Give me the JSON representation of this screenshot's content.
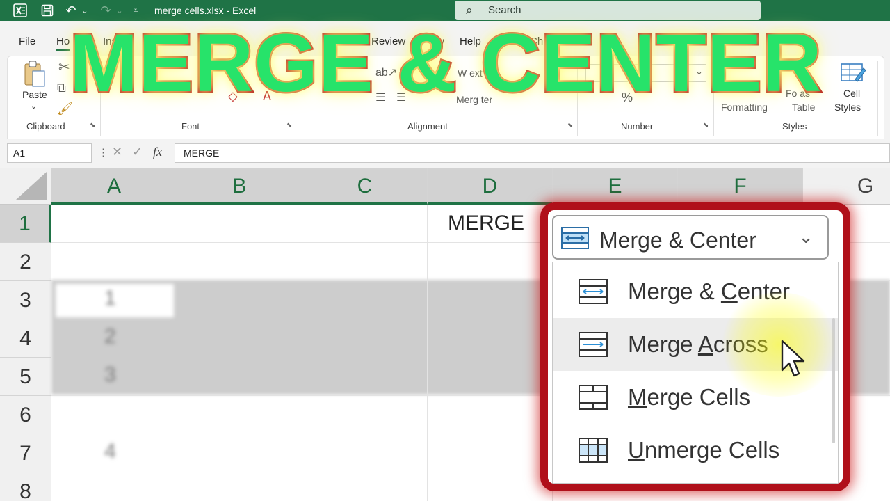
{
  "titlebar": {
    "doc_title": "merge cells.xlsx  -  Excel",
    "search_placeholder": "Search",
    "icons": [
      "excel-logo",
      "save",
      "undo",
      "redo",
      "customize"
    ]
  },
  "ribbon": {
    "tabs": [
      "File",
      "Ho",
      "Inse",
      "D",
      "Review",
      "w",
      "Help",
      "Ch"
    ],
    "groups": {
      "clipboard": {
        "label": "Clipboard",
        "paste": "Paste"
      },
      "font": {
        "label": "Font"
      },
      "alignment": {
        "label": "Alignment",
        "wrap_text": "W    ext",
        "merge": "Merg         ter"
      },
      "number": {
        "label": "Number"
      },
      "styles": {
        "label": "Styles",
        "cond_format": "Formatting",
        "format_table_1": "Fo      as",
        "format_table_2": "Table",
        "cell_styles_1": "Cell",
        "cell_styles_2": "Styles"
      }
    }
  },
  "overlay": {
    "title": "MERGE & CENTER"
  },
  "formula_bar": {
    "name_box": "A1",
    "formula": "MERGE",
    "fx": "fx"
  },
  "sheet": {
    "columns": [
      "A",
      "B",
      "C",
      "D",
      "E",
      "F",
      "G"
    ],
    "rows": [
      "1",
      "2",
      "3",
      "4",
      "5",
      "6",
      "7",
      "8"
    ],
    "merged_value": "MERGE",
    "blurred_values": [
      "1",
      "2",
      "3",
      "4"
    ]
  },
  "merge_dropdown": {
    "button_label": "Merge & Center",
    "items": [
      {
        "label": "Merge & Center",
        "icon": "merge-center-icon"
      },
      {
        "label": "Merge Across",
        "icon": "merge-across-icon"
      },
      {
        "label": "Merge Cells",
        "icon": "merge-cells-icon"
      },
      {
        "label": "Unmerge Cells",
        "icon": "unmerge-cells-icon"
      }
    ],
    "hovered_item": "Merge Across"
  },
  "colors": {
    "excel_green": "#1f7346",
    "highlight_red": "#b0101a",
    "overlay_green": "#27e36a"
  }
}
